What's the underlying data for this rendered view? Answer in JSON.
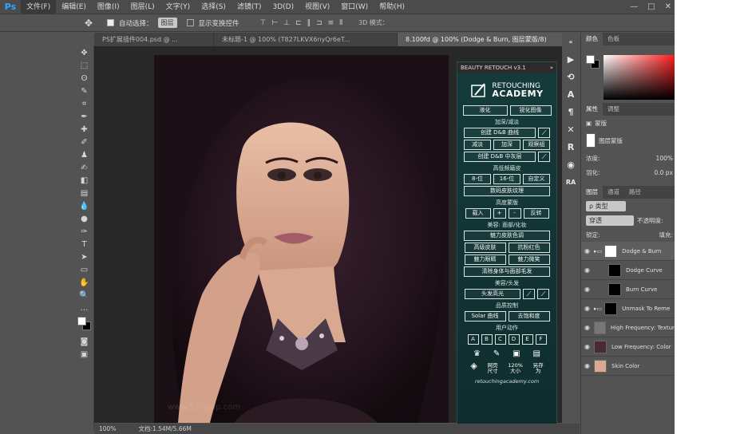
{
  "app": {
    "logo": "Ps",
    "window_controls": [
      "—",
      "□",
      "✕"
    ]
  },
  "menu": [
    "文件(F)",
    "编辑(E)",
    "图像(I)",
    "图层(L)",
    "文字(Y)",
    "选择(S)",
    "滤镜(T)",
    "3D(D)",
    "视图(V)",
    "窗口(W)",
    "帮助(H)"
  ],
  "options": {
    "auto_select_label": "自动选择：",
    "auto_select_value": "图层",
    "transform_label": "显示变换控件",
    "mode_3d": "3D 模式："
  },
  "tabs": [
    "PS扩展插件004.psd @ ...",
    "未标题-1 @ 100% (T827LKVX6nyQr6eT...",
    "8.100fd @ 100% (Dodge & Burn, 图层蒙版/8)"
  ],
  "status": {
    "zoom": "100%",
    "doc": "文档:1.54M/5.66M"
  },
  "panel": {
    "title": "BEAUTY RETOUCH v3.1",
    "logo_top": "RETOUCHING",
    "logo_bottom": "ACADEMY",
    "row1": [
      "液化",
      "锐化图像"
    ],
    "sec_dodge": "加深/减淡",
    "dodge_curve": "创建 D&B 曲线",
    "dodge_row": [
      "减淡",
      "加深",
      "观察组"
    ],
    "dodge_mid": "创建 D&B 中灰层",
    "sec_freq": "高低频磨皮",
    "freq_row": [
      "8-位",
      "16-位",
      "自定义"
    ],
    "texture": "数码皮肤纹理",
    "sec_mask": "高度蒙版",
    "mask_row": [
      "载入",
      "+",
      "-",
      "反转"
    ],
    "sec_face": "美容: 面部/化妆",
    "skin_tone": "魅力皮肤色调",
    "face_row1": [
      "高级皮肤",
      "抗粉红色"
    ],
    "face_row2": [
      "魅力眼睛",
      "魅力微笑"
    ],
    "hair_clean": "清除身体与面部毛发",
    "sec_hair": "美容/头发",
    "hair_light": "头发高光",
    "sec_quality": "品质控制",
    "quality_row": [
      "Solar 曲线",
      "去饱和度"
    ],
    "sec_actions": "用户动作",
    "letters": [
      "A",
      "B",
      "C",
      "D",
      "E",
      "F"
    ],
    "bottom": [
      [
        "网页",
        "尺寸"
      ],
      [
        "120%",
        "大小"
      ],
      [
        "另存",
        "为"
      ]
    ],
    "url": "retouchingacademy.com"
  },
  "right": {
    "color_tabs": [
      "颜色",
      "色板"
    ],
    "prop_tabs": [
      "属性",
      "调整"
    ],
    "prop_mask": "蒙版",
    "prop_layer_mask": "图层蒙版",
    "density_label": "浓度:",
    "density_value": "100%",
    "feather_label": "羽化:",
    "feather_value": "0.0 px",
    "layers_tabs": [
      "图层",
      "通道",
      "路径"
    ],
    "filter": "ρ 类型",
    "blend": "穿透",
    "opacity_label": "不透明度:",
    "lock_label": "锁定:",
    "fill_label": "填充:",
    "layers": [
      "Dodge & Burn",
      "Dodge Curve",
      "Burn Curve",
      "Unmask To Reme",
      "High Frequency: Texture",
      "Low Frequency: Color",
      "Skin Color"
    ]
  },
  "watermark": "www.51cgvip.com"
}
